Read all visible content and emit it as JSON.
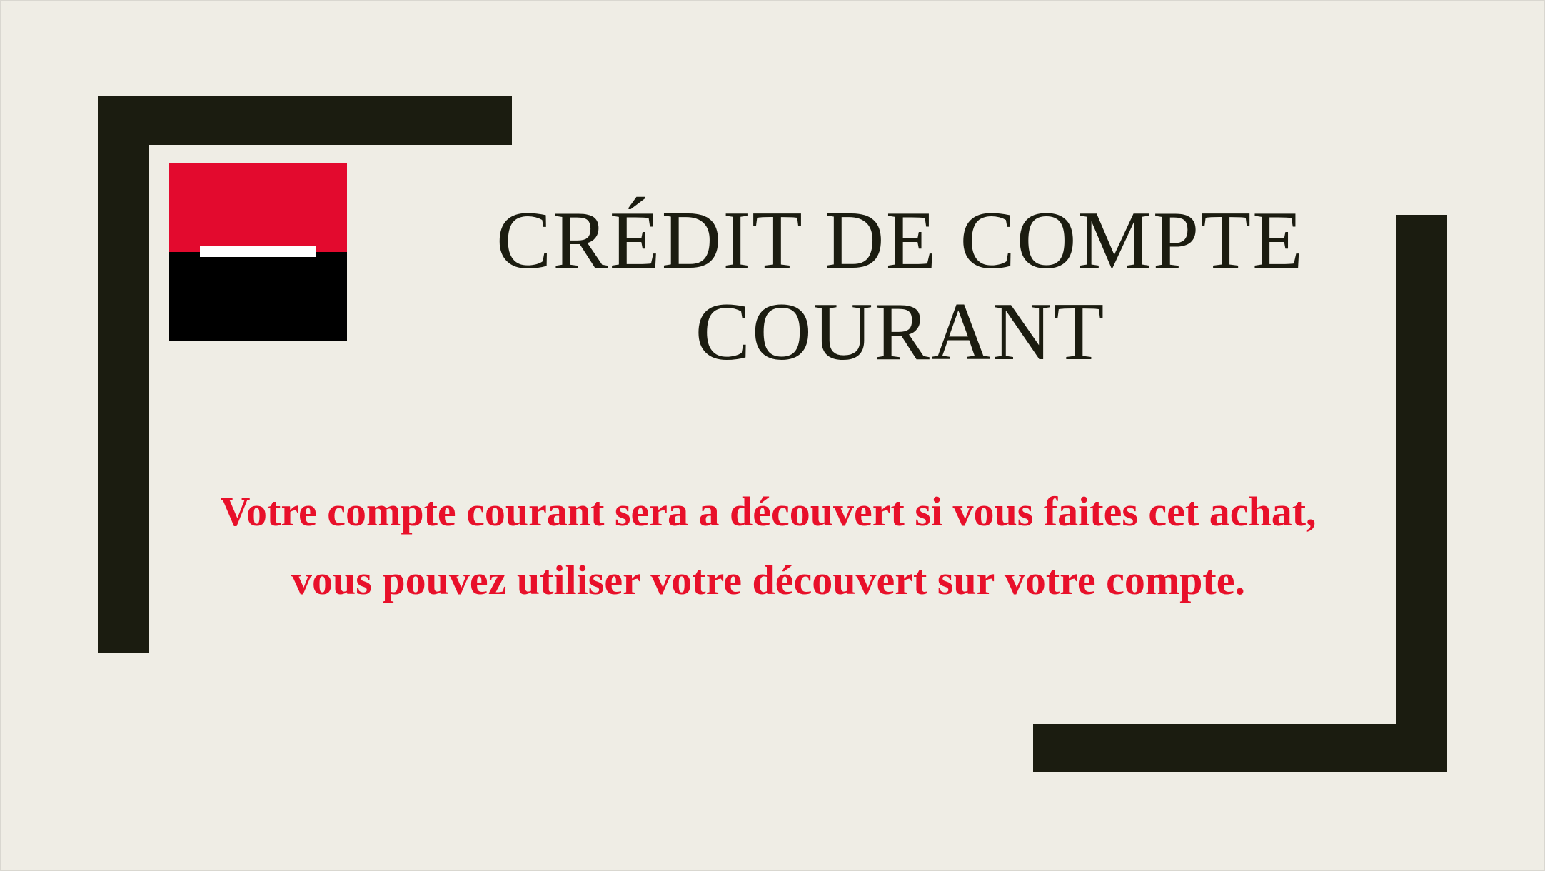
{
  "slide": {
    "title_lines": [
      "CRÉDIT DE COMPTE",
      "COURANT"
    ],
    "message": "Votre compte courant sera a découvert si vous faites cet achat, vous pouvez utiliser votre découvert sur votre compte."
  },
  "logo": {
    "icon": "bank-logo-icon",
    "top_color": "#e30a2e",
    "bottom_color": "#000000"
  },
  "colors": {
    "background": "#efede5",
    "bracket": "#1b1c10",
    "title": "#1b1c10",
    "message": "#e8102a"
  }
}
